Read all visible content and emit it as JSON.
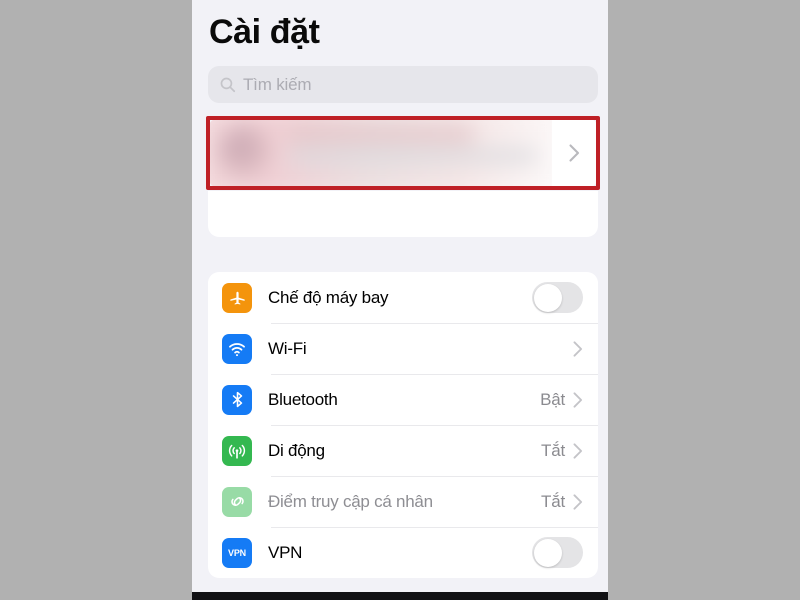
{
  "window": {
    "background_color": "#b1b1b1",
    "phone_background": "#f2f2f7"
  },
  "header": {
    "title": "Cài đặt"
  },
  "search": {
    "placeholder": "Tìm kiếm",
    "value": "",
    "icon": "search-icon"
  },
  "account": {
    "redacted": true,
    "blurred_label": "",
    "blurred_sublabel": "",
    "chevron": "chevron-right-icon",
    "highlight": {
      "color": "#bf2026",
      "style": "rectangle-outline"
    }
  },
  "settings_group": {
    "rows": [
      {
        "label": "Chế độ máy bay",
        "icon": "airplane-icon",
        "icon_color": "#f4940c",
        "control": "toggle",
        "toggle_on": false,
        "value": "",
        "disabled": false
      },
      {
        "label": "Wi-Fi",
        "icon": "wifi-icon",
        "icon_color": "#157bf5",
        "control": "chevron",
        "value": "",
        "disabled": false
      },
      {
        "label": "Bluetooth",
        "icon": "bluetooth-icon",
        "icon_color": "#157bf5",
        "control": "chevron",
        "value": "Bật",
        "disabled": false
      },
      {
        "label": "Di động",
        "icon": "cellular-antenna-icon",
        "icon_color": "#34b850",
        "control": "chevron",
        "value": "Tắt",
        "disabled": false
      },
      {
        "label": "Điểm truy cập cá nhân",
        "icon": "personal-hotspot-icon",
        "icon_color": "#7ed694",
        "control": "chevron",
        "value": "Tắt",
        "disabled": true
      },
      {
        "label": "VPN",
        "icon": "vpn-icon",
        "icon_color": "#157bf5",
        "icon_text": "VPN",
        "control": "toggle",
        "toggle_on": false,
        "value": "",
        "disabled": false
      }
    ]
  }
}
